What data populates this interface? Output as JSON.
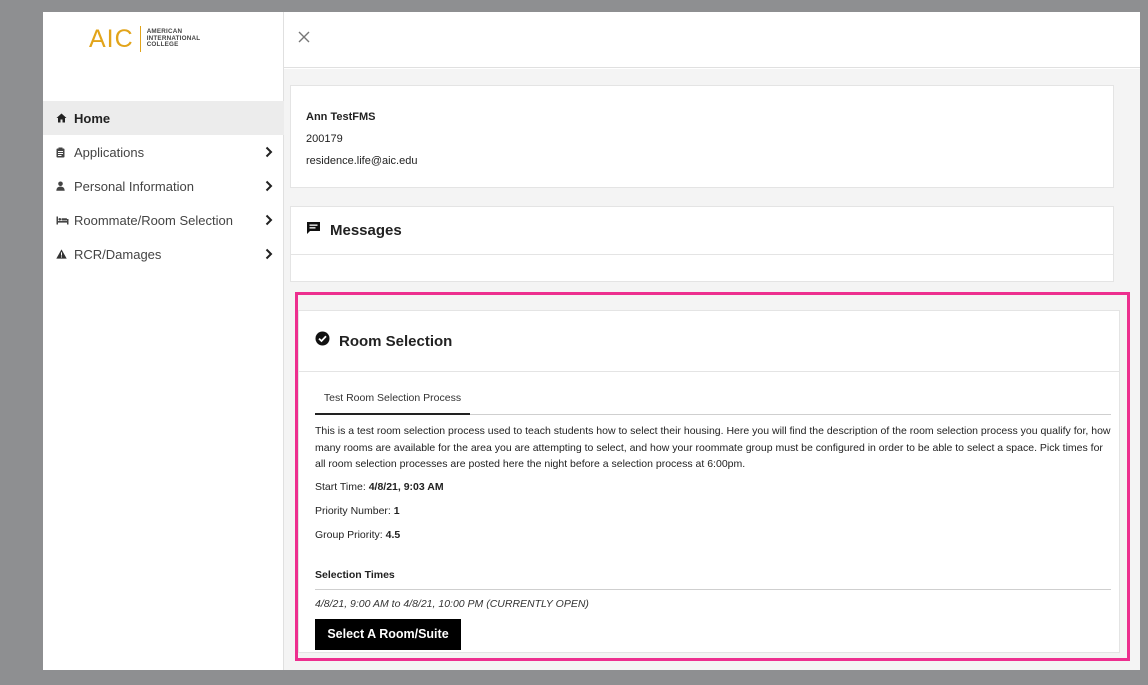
{
  "logo": {
    "mark": "AIC",
    "line1": "AMERICAN",
    "line2": "INTERNATIONAL",
    "line3": "COLLEGE",
    "color": "#e2a41a"
  },
  "sidebar": {
    "items": [
      {
        "label": "Home",
        "icon": "home-icon",
        "active": true
      },
      {
        "label": "Applications",
        "icon": "clipboard-icon"
      },
      {
        "label": "Personal Information",
        "icon": "user-icon"
      },
      {
        "label": "Roommate/Room Selection",
        "icon": "bed-icon"
      },
      {
        "label": "RCR/Damages",
        "icon": "warning-icon"
      }
    ]
  },
  "profile": {
    "name": "Ann TestFMS",
    "id": "200179",
    "email": "residence.life@aic.edu"
  },
  "messages": {
    "title": "Messages"
  },
  "room_selection": {
    "title": "Room Selection",
    "tab": "Test Room Selection Process",
    "description": "This is a test room selection process used to teach students how to select their housing. Here you will find the description of the room selection process you qualify for, how many rooms are available for the area you are attempting to select, and how your roommate group must be configured in order to be able to select a space. Pick times for all room selection processes are posted here the night before a selection process at 6:00pm.",
    "start_time_label": "Start Time:",
    "start_time_value": "4/8/21, 9:03 AM",
    "priority_label": "Priority Number:",
    "priority_value": "1",
    "group_priority_label": "Group Priority:",
    "group_priority_value": "4.5",
    "selection_times_title": "Selection Times",
    "selection_time": "4/8/21, 9:00 AM to 4/8/21, 10:00 PM (CURRENTLY OPEN)",
    "button_label": "Select A Room/Suite"
  },
  "colors": {
    "highlight": "#ed2f8f",
    "button_bg": "#000000",
    "active_nav_bg": "#ececec"
  }
}
